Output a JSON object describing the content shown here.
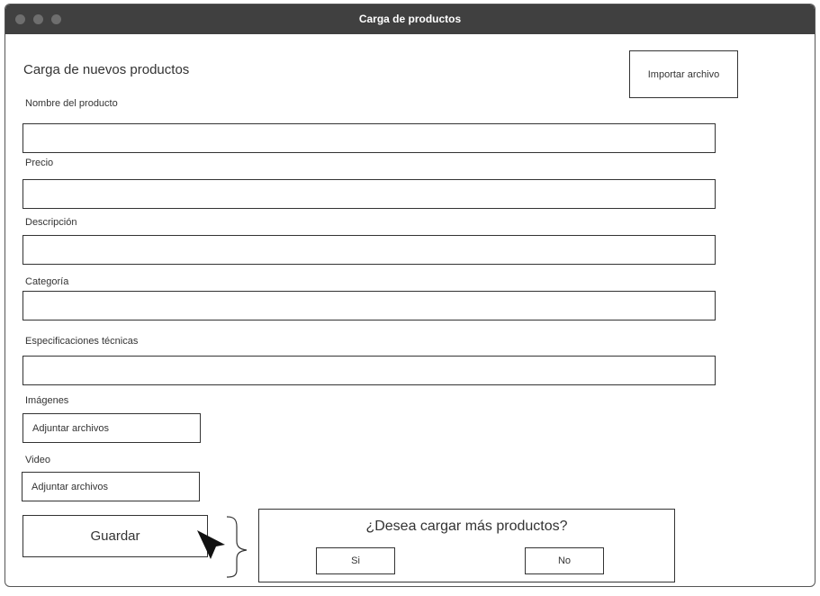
{
  "window": {
    "title": "Carga de productos"
  },
  "form": {
    "title": "Carga de nuevos productos",
    "import_button": "Importar archivo",
    "fields": [
      {
        "label": "Nombre del producto",
        "value": "",
        "placeholder": ""
      },
      {
        "label": "Precio",
        "value": "",
        "placeholder": ""
      },
      {
        "label": "Descripción",
        "value": "",
        "placeholder": ""
      },
      {
        "label": "Categoría",
        "value": "",
        "placeholder": ""
      },
      {
        "label": "Especificaciones técnicas",
        "value": "",
        "placeholder": ""
      }
    ],
    "images": {
      "label": "Imágenes",
      "button": "Adjuntar archivos"
    },
    "video": {
      "label": "Video",
      "button": "Adjuntar archivos"
    },
    "save_button": "Guardar"
  },
  "dialog": {
    "question": "¿Desea cargar más productos?",
    "yes_button": "Si",
    "no_button": "No"
  }
}
